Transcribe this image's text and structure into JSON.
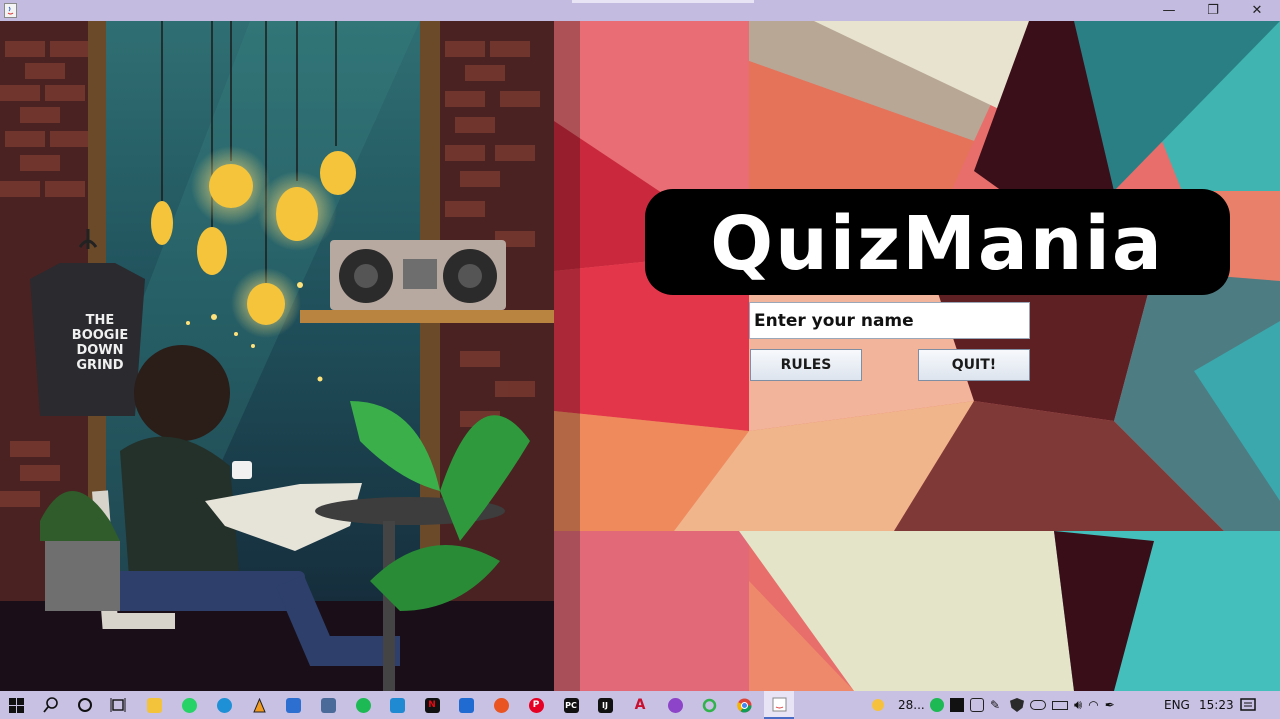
{
  "window": {
    "minimize_glyph": "—",
    "restore_glyph": "❐",
    "close_glyph": "✕"
  },
  "app": {
    "logo_text": "QuizMania",
    "name_placeholder": "Enter your name",
    "name_value": "",
    "rules_label": "RULES",
    "quit_label": "QUIT!",
    "poster_lines": [
      "THE",
      "BOOGIE",
      "DOWN",
      "GRIND"
    ]
  },
  "colors": {
    "titlebar": "#c4bce0",
    "taskbar": "#c9c1e3",
    "button_bg": "#e4e9f1",
    "button_border": "#7f8ea3"
  },
  "taskbar": {
    "apps": [
      {
        "name": "start",
        "icon": "windows-logo"
      },
      {
        "name": "search",
        "icon": "search-icon"
      },
      {
        "name": "cortana",
        "icon": "circle-icon"
      },
      {
        "name": "task-view",
        "icon": "task-view-icon"
      },
      {
        "name": "file-explorer",
        "icon": "folder-icon"
      },
      {
        "name": "whatsapp",
        "icon": "whatsapp-icon"
      },
      {
        "name": "edge",
        "icon": "edge-icon"
      },
      {
        "name": "vlc-like",
        "icon": "cone-icon"
      },
      {
        "name": "store",
        "icon": "store-icon"
      },
      {
        "name": "calculator",
        "icon": "calculator-icon"
      },
      {
        "name": "spotify",
        "icon": "spotify-icon"
      },
      {
        "name": "vscode",
        "icon": "vscode-icon"
      },
      {
        "name": "netflix",
        "icon": "netflix-icon",
        "letter": "N"
      },
      {
        "name": "mail",
        "icon": "mail-icon"
      },
      {
        "name": "ubuntu",
        "icon": "ubuntu-icon"
      },
      {
        "name": "pinterest",
        "icon": "pinterest-icon",
        "letter": "P"
      },
      {
        "name": "pycharm",
        "icon": "pycharm-icon",
        "letter": "PC"
      },
      {
        "name": "intellij",
        "icon": "intellij-icon",
        "letter": "IJ"
      },
      {
        "name": "acrobat",
        "icon": "acrobat-icon",
        "letter": "A"
      },
      {
        "name": "podcasts",
        "icon": "podcast-icon"
      },
      {
        "name": "refresh-app",
        "icon": "ring-icon"
      },
      {
        "name": "chrome",
        "icon": "chrome-icon"
      },
      {
        "name": "java-app",
        "icon": "java-icon"
      }
    ],
    "tray": {
      "weather_text": "28...",
      "language": "ENG",
      "time": "15:23"
    }
  }
}
